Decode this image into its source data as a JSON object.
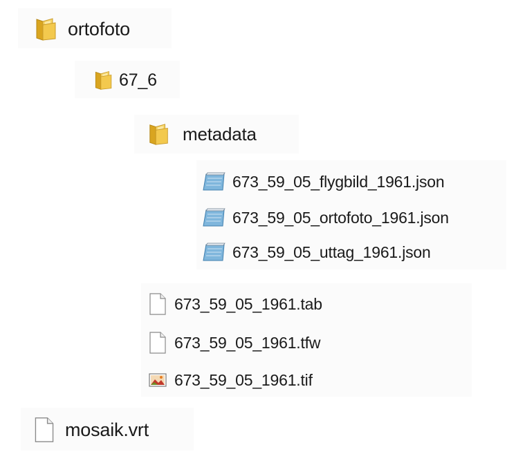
{
  "tree": {
    "root_folder": {
      "name": "ortofoto",
      "icon": "folder-icon"
    },
    "sub_folder": {
      "name": "67_6",
      "icon": "folder-icon"
    },
    "metadata_folder": {
      "name": "metadata",
      "icon": "folder-icon"
    },
    "metadata_files": [
      {
        "name": "673_59_05_flygbild_1961.json",
        "icon": "text-document-icon"
      },
      {
        "name": "673_59_05_ortofoto_1961.json",
        "icon": "text-document-icon"
      },
      {
        "name": "673_59_05_uttag_1961.json",
        "icon": "text-document-icon"
      }
    ],
    "data_files": [
      {
        "name": "673_59_05_1961.tab",
        "icon": "blank-file-icon"
      },
      {
        "name": "673_59_05_1961.tfw",
        "icon": "blank-file-icon"
      },
      {
        "name": "673_59_05_1961.tif",
        "icon": "image-file-icon"
      }
    ],
    "bottom_file": {
      "name": "mosaik.vrt",
      "icon": "blank-file-icon"
    }
  }
}
